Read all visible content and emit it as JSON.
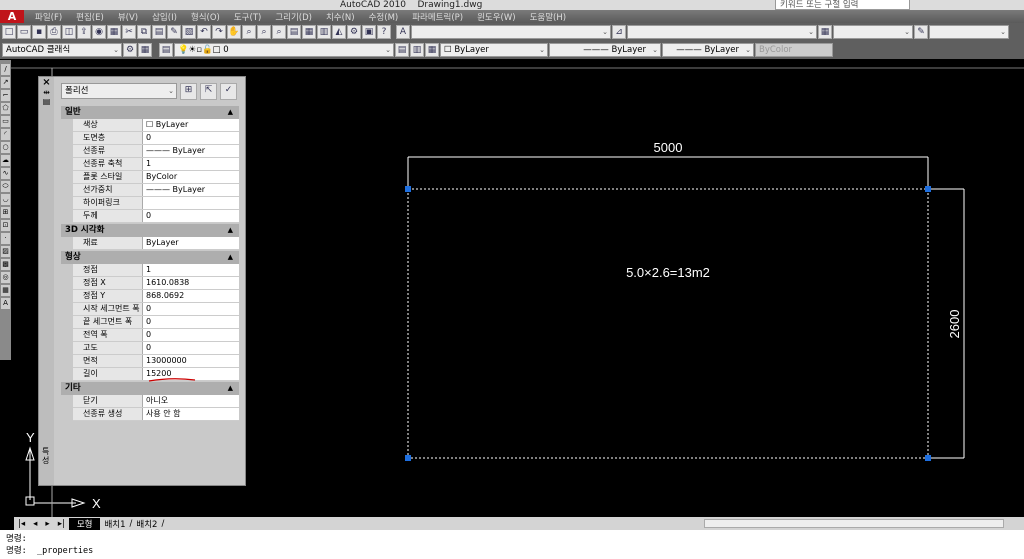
{
  "title": {
    "app": "AutoCAD 2010",
    "file": "Drawing1.dwg",
    "search_placeholder": "키워드 또는 구절 입력"
  },
  "menu": [
    "파일(F)",
    "편집(E)",
    "뷰(V)",
    "삽입(I)",
    "형식(O)",
    "도구(T)",
    "그리기(D)",
    "치수(N)",
    "수정(M)",
    "파라메트릭(P)",
    "윈도우(W)",
    "도움말(H)"
  ],
  "toolbar2": {
    "workspace": "AutoCAD 클래식",
    "layer": "0",
    "color": "ByLayer",
    "linetype": "ByLayer",
    "lineweight": "ByLayer",
    "plotstyle": "ByColor"
  },
  "properties": {
    "object_type": "폴리선",
    "side_label": "특성",
    "sections": [
      {
        "title": "일반",
        "rows": [
          [
            "색상",
            "☐ ByLayer"
          ],
          [
            "도면층",
            "0"
          ],
          [
            "선종류",
            "——— ByLayer"
          ],
          [
            "선종류 축척",
            "1"
          ],
          [
            "플롯 스타일",
            "ByColor"
          ],
          [
            "선가중치",
            "——— ByLayer"
          ],
          [
            "하이퍼링크",
            ""
          ],
          [
            "두께",
            "0"
          ]
        ]
      },
      {
        "title": "3D 시각화",
        "rows": [
          [
            "재료",
            "ByLayer"
          ]
        ]
      },
      {
        "title": "형상",
        "rows": [
          [
            "정점",
            "1"
          ],
          [
            "정점 X",
            "1610.0838"
          ],
          [
            "정점 Y",
            "868.0692"
          ],
          [
            "시작 세그먼트 폭",
            "0"
          ],
          [
            "끝 세그먼트 폭",
            "0"
          ],
          [
            "전역 폭",
            "0"
          ],
          [
            "고도",
            "0"
          ],
          [
            "면적",
            "13000000"
          ],
          [
            "길이",
            "15200"
          ]
        ]
      },
      {
        "title": "기타",
        "rows": [
          [
            "닫기",
            "아니오"
          ],
          [
            "선종류 생성",
            "사용 안 함"
          ]
        ]
      }
    ]
  },
  "drawing": {
    "dim_width": "5000",
    "dim_height": "2600",
    "note": "5.0×2.6=13m2",
    "ucs_x": "X",
    "ucs_y": "Y"
  },
  "tabs": [
    "모형",
    "배치1",
    "배치2"
  ],
  "command": [
    "명령:",
    "명령:  _properties"
  ]
}
